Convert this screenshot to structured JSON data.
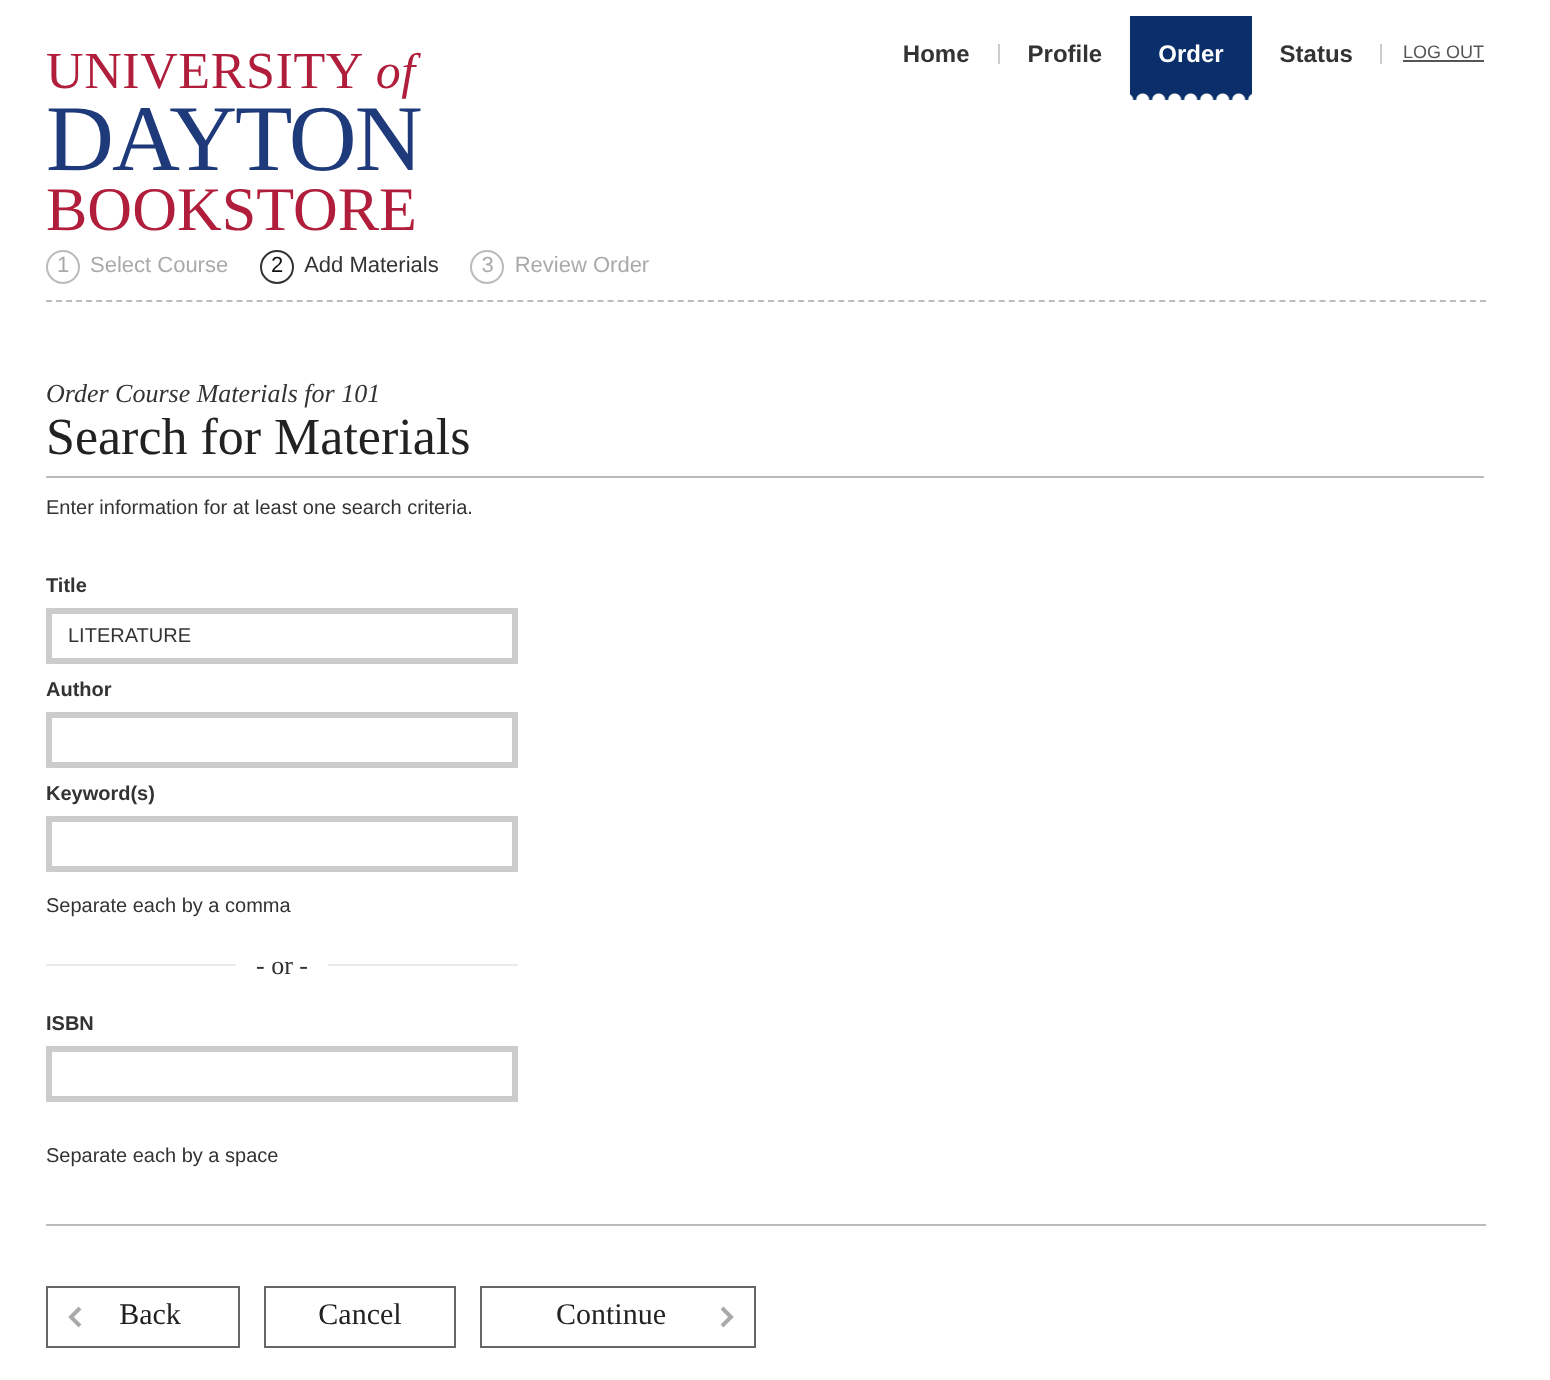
{
  "logo": {
    "line_1": "UNIVERSITY",
    "line_1_suffix": "of",
    "line_2": "DAYTON",
    "line_3": "BOOKSTORE"
  },
  "nav": [
    {
      "label": "Home",
      "kind": "tab",
      "selected": false
    },
    {
      "label": "Profile",
      "kind": "tab",
      "selected": false
    },
    {
      "label": "Order",
      "kind": "tab",
      "selected": true
    },
    {
      "label": "Status",
      "kind": "tab",
      "selected": false
    },
    {
      "label": "LOG OUT",
      "kind": "link"
    }
  ],
  "steps": [
    {
      "number": "1",
      "label": "Select Course",
      "selected": false
    },
    {
      "number": "2",
      "label": "Add Materials",
      "selected": true
    },
    {
      "number": "3",
      "label": "Review Order",
      "selected": false
    }
  ],
  "subtitle": "Order Course Materials for 101",
  "heading": "Search for Materials",
  "instruction": "Enter information for at least one search criteria.",
  "fields": [
    {
      "label": "Title",
      "value": "LITERATURE"
    },
    {
      "label": "Author"
    },
    {
      "label": "Keyword(s)",
      "hint": "Separate each by a comma"
    },
    {
      "kind": "divider",
      "label": "- or -"
    },
    {
      "label": "ISBN",
      "hint": "Separate each by a space"
    }
  ],
  "buttons": [
    {
      "label": "Back",
      "kind": "back"
    },
    {
      "label": "Cancel",
      "kind": "plain"
    },
    {
      "label": "Continue",
      "kind": "next"
    }
  ]
}
